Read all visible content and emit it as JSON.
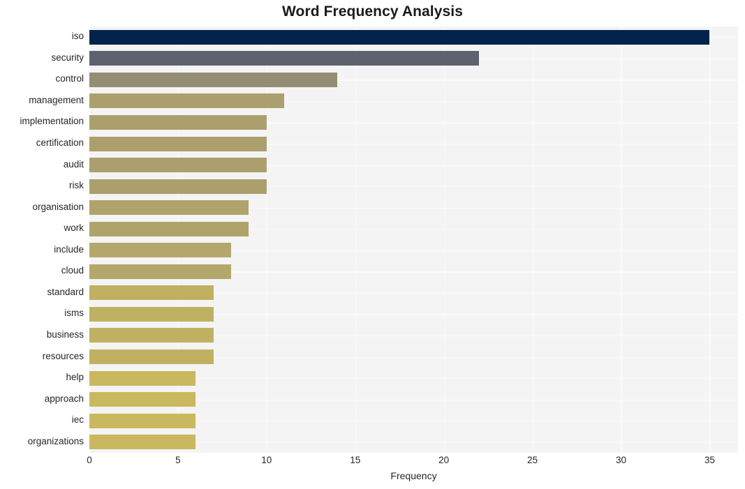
{
  "chart_data": {
    "type": "bar",
    "orientation": "horizontal",
    "title": "Word Frequency Analysis",
    "xlabel": "Frequency",
    "ylabel": "",
    "xlim": [
      0,
      36.6
    ],
    "xticks": [
      0,
      5,
      10,
      15,
      20,
      25,
      30,
      35
    ],
    "xtick_labels": [
      "0",
      "5",
      "10",
      "15",
      "20",
      "25",
      "30",
      "35"
    ],
    "grid": true,
    "grid_color": "#fafafa",
    "plot_background": "#f4f4f4",
    "figure_background": "#ffffff",
    "legend": null,
    "categories": [
      "iso",
      "security",
      "control",
      "management",
      "implementation",
      "certification",
      "audit",
      "risk",
      "organisation",
      "work",
      "include",
      "cloud",
      "standard",
      "isms",
      "business",
      "resources",
      "help",
      "approach",
      "iec",
      "organizations"
    ],
    "values": [
      35,
      22,
      14,
      11,
      10,
      10,
      10,
      10,
      9,
      9,
      8,
      8,
      7,
      7,
      7,
      7,
      6,
      6,
      6,
      6
    ],
    "bar_colors": [
      "#04234c",
      "#5e616e",
      "#948d75",
      "#ab9f6d",
      "#ab9f6d",
      "#ab9f6d",
      "#ab9f6d",
      "#ab9f6d",
      "#afa36c",
      "#afa36c",
      "#b3a76b",
      "#b3a76b",
      "#c0b162",
      "#c0b162",
      "#c0b162",
      "#c0b162",
      "#c9b85d",
      "#c9b85d",
      "#c9b85d",
      "#c9b85d"
    ]
  }
}
